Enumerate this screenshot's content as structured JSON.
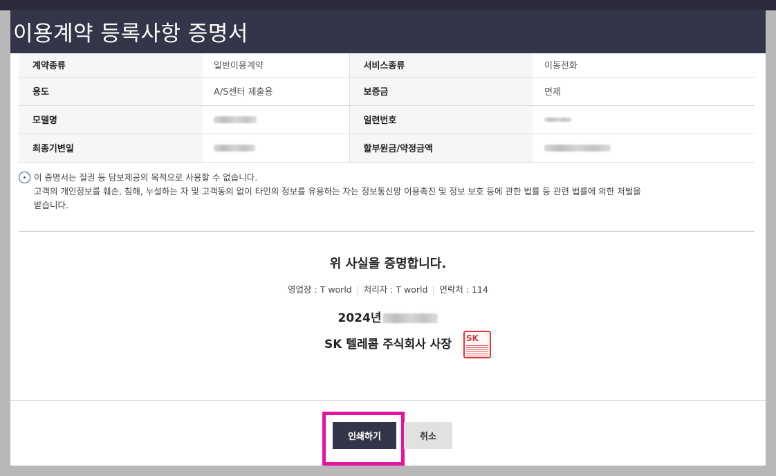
{
  "dialog": {
    "title": "이용계약 등록사항 증명서"
  },
  "table": {
    "rows": [
      {
        "label1": "계약종류",
        "value1": "일반이용계약",
        "label2": "서비스종류",
        "value2": "이동전화"
      },
      {
        "label1": "용도",
        "value1": "A/S센터 제출용",
        "label2": "보증금",
        "value2": "면제"
      },
      {
        "label1": "모델명",
        "value1": "",
        "label2": "일련번호",
        "value2": ""
      },
      {
        "label1": "최종기변일",
        "value1": "",
        "label2": "할부원금/약정금액",
        "value2": ""
      }
    ]
  },
  "notice": {
    "line1": "이 증명서는 질권 등 담보제공의 목적으로 사용할 수 없습니다.",
    "line2": "고객의 개인정보를 훼손, 침해, 누설하는 자 및 고객동의 없이 타인의 정보를 유용하는 자는 정보통신망 이용촉진 및 정보 보호 등에 관한 법률 등 관련 법률에 의한 처벌을",
    "line3": "받습니다."
  },
  "certificate": {
    "statement": "위 사실을 증명합니다.",
    "office": "영업장 : T world",
    "handler": "처리자 : T world",
    "contact": "연락처 : 114",
    "date_prefix": "2024년",
    "company": "SK 텔레콤 주식회사 사장",
    "seal_text": "SK"
  },
  "buttons": {
    "print": "인쇄하기",
    "cancel": "취소"
  },
  "colors": {
    "titlebar": "#353549",
    "print_button": "#353549",
    "highlight": "#e5149e",
    "seal": "#d83838"
  }
}
